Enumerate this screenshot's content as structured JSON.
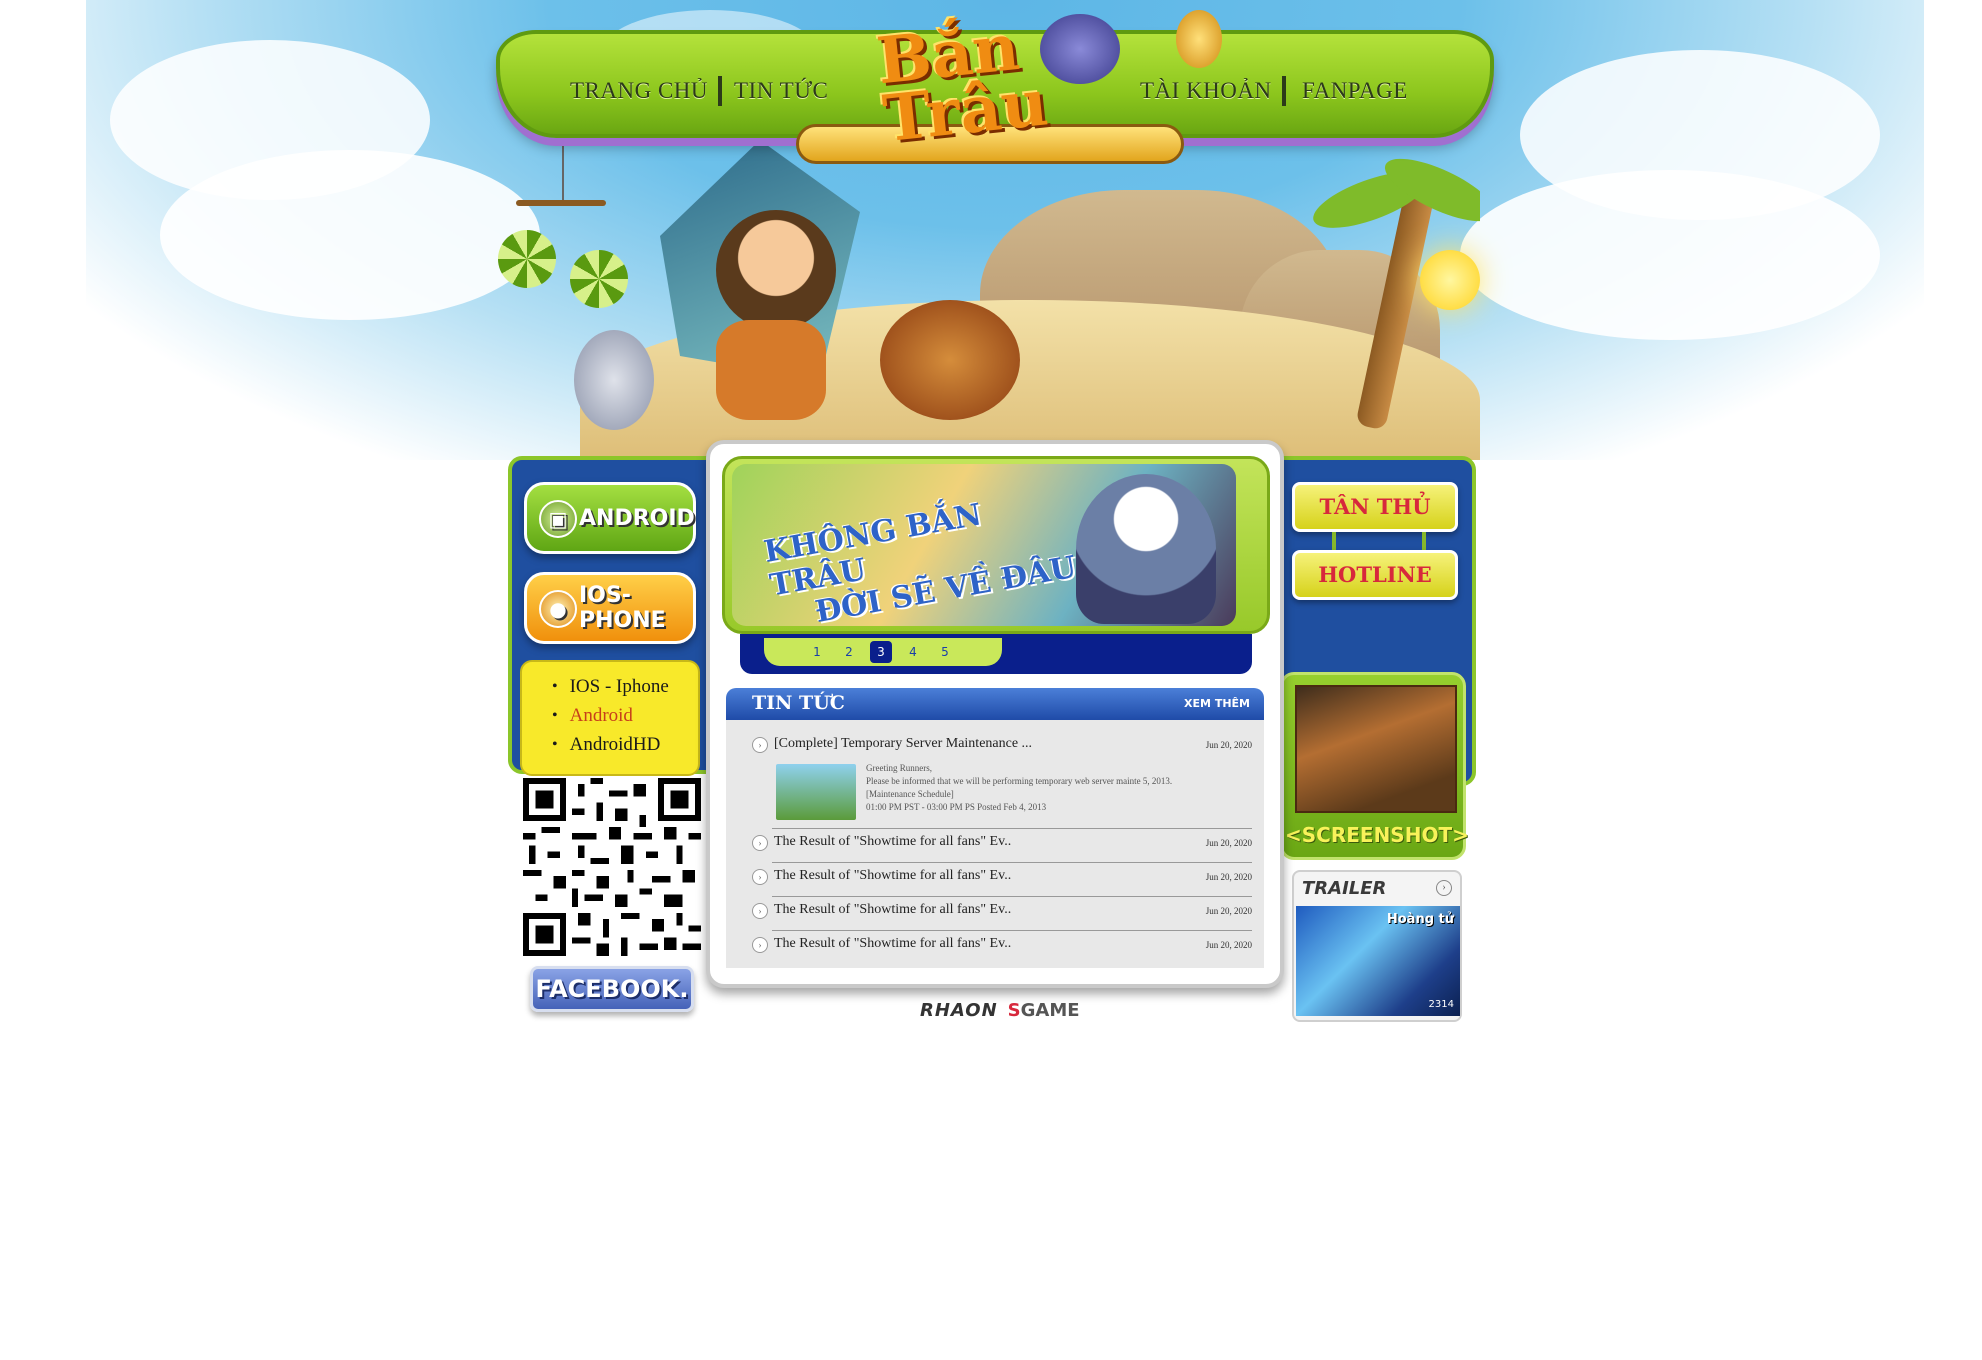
{
  "logo": {
    "title": "Bắn Trâu"
  },
  "nav": {
    "home": "TRANG CHỦ",
    "news": "TIN TỨC",
    "account": "TÀI KHOẢN",
    "fanpage": "FANPAGE"
  },
  "left": {
    "android_label": "ANDROID",
    "ios_label": "IOS-PHONE",
    "platforms": [
      "IOS - Iphone",
      "Android",
      "AndroidHD"
    ],
    "facebook_label": "FACEBOOK."
  },
  "right": {
    "tanthu_label": "TÂN THỦ",
    "hotline_label": "HOTLINE",
    "screenshot_label": "<SCREENSHOT>",
    "trailer_label": "TRAILER",
    "trailer_caption": "Hoàng tử",
    "trailer_count": "2314"
  },
  "banner": {
    "line1": "KHÔNG BẮN TRÂU",
    "line2": "ĐỜI SẼ VỀ ĐÂU",
    "pages": [
      "1",
      "2",
      "3",
      "4",
      "5"
    ],
    "active_page": "3"
  },
  "news": {
    "title": "TIN TỨC",
    "more": "XEM THÊM",
    "featured": {
      "title": "[Complete] Temporary Server Maintenance ...",
      "date": "Jun 20, 2020",
      "lines": [
        "Greeting Runners,",
        "Please be informed that we will be performing temporary web server mainte  5, 2013.",
        "[Maintenance Schedule]",
        "01:00 PM PST - 03:00 PM PS Posted Feb 4, 2013"
      ]
    },
    "items": [
      {
        "title": "The Result of \"Showtime for all fans\" Ev..",
        "date": "Jun 20, 2020"
      },
      {
        "title": "The Result of \"Showtime for all fans\" Ev..",
        "date": "Jun 20, 2020"
      },
      {
        "title": "The Result of \"Showtime for all fans\" Ev..",
        "date": "Jun 20, 2020"
      },
      {
        "title": "The Result of \"Showtime for all fans\" Ev..",
        "date": "Jun 20, 2020"
      }
    ]
  },
  "footer": {
    "publisher1": "RHAON",
    "publisher2_s": "S",
    "publisher2": "GAME"
  },
  "colors": {
    "nav_green": "#8cc61d",
    "panel_blue": "#1f4fa0",
    "accent_red": "#d7283c",
    "yellow": "#f8e92a"
  }
}
